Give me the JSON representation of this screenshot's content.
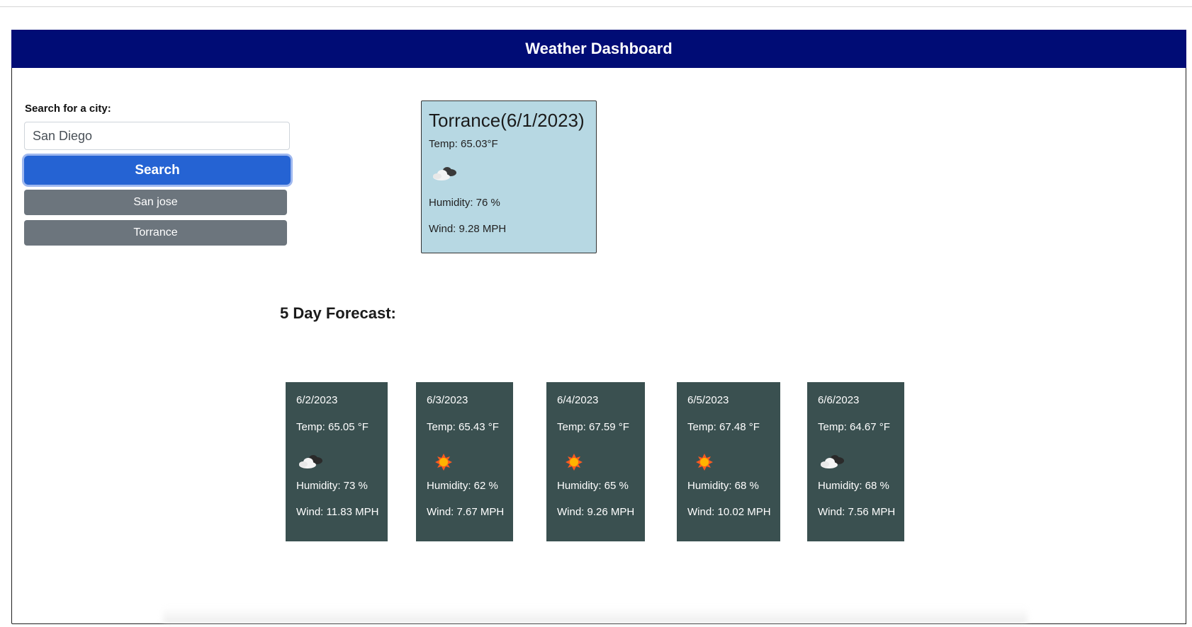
{
  "app": {
    "title": "Weather Dashboard"
  },
  "search": {
    "label": "Search for a city:",
    "value": "San Diego",
    "button_label": "Search"
  },
  "history": [
    {
      "label": "San jose"
    },
    {
      "label": "Torrance"
    }
  ],
  "current": {
    "title": "Torrance(6/1/2023)",
    "temp": "Temp: 65.03°F",
    "icon": "cloudy-icon",
    "humidity": "Humidity: 76 %",
    "wind": "Wind: 9.28 MPH"
  },
  "forecast": {
    "heading": "5 Day Forecast:",
    "days": [
      {
        "date": "6/2/2023",
        "temp": "Temp: 65.05 °F",
        "icon": "cloudy-icon",
        "humidity": "Humidity: 73 %",
        "wind": "Wind: 11.83 MPH"
      },
      {
        "date": "6/3/2023",
        "temp": "Temp: 65.43 °F",
        "icon": "sun-icon",
        "humidity": "Humidity: 62 %",
        "wind": "Wind: 7.67 MPH"
      },
      {
        "date": "6/4/2023",
        "temp": "Temp: 67.59 °F",
        "icon": "sun-icon",
        "humidity": "Humidity: 65 %",
        "wind": "Wind: 9.26 MPH"
      },
      {
        "date": "6/5/2023",
        "temp": "Temp: 67.48 °F",
        "icon": "sun-icon",
        "humidity": "Humidity: 68 %",
        "wind": "Wind: 10.02 MPH"
      },
      {
        "date": "6/6/2023",
        "temp": "Temp: 64.67 °F",
        "icon": "cloudy-icon",
        "humidity": "Humidity: 68 %",
        "wind": "Wind: 7.56 MPH"
      }
    ]
  },
  "colors": {
    "header_bg": "#000c75",
    "search_button": "#2563d3",
    "history_button": "#6c757d",
    "current_card": "#b7d8e3",
    "forecast_card": "#3a5050"
  }
}
